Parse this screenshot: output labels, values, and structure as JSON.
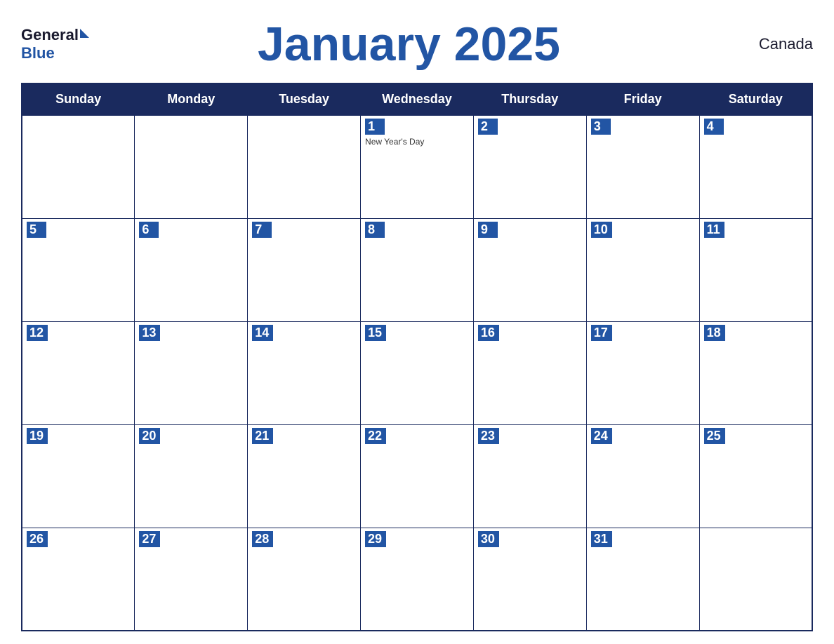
{
  "header": {
    "logo_general": "General",
    "logo_blue": "Blue",
    "title": "January 2025",
    "country": "Canada"
  },
  "days_of_week": [
    "Sunday",
    "Monday",
    "Tuesday",
    "Wednesday",
    "Thursday",
    "Friday",
    "Saturday"
  ],
  "weeks": [
    [
      {
        "day": "",
        "event": ""
      },
      {
        "day": "",
        "event": ""
      },
      {
        "day": "",
        "event": ""
      },
      {
        "day": "1",
        "event": "New Year's Day"
      },
      {
        "day": "2",
        "event": ""
      },
      {
        "day": "3",
        "event": ""
      },
      {
        "day": "4",
        "event": ""
      }
    ],
    [
      {
        "day": "5",
        "event": ""
      },
      {
        "day": "6",
        "event": ""
      },
      {
        "day": "7",
        "event": ""
      },
      {
        "day": "8",
        "event": ""
      },
      {
        "day": "9",
        "event": ""
      },
      {
        "day": "10",
        "event": ""
      },
      {
        "day": "11",
        "event": ""
      }
    ],
    [
      {
        "day": "12",
        "event": ""
      },
      {
        "day": "13",
        "event": ""
      },
      {
        "day": "14",
        "event": ""
      },
      {
        "day": "15",
        "event": ""
      },
      {
        "day": "16",
        "event": ""
      },
      {
        "day": "17",
        "event": ""
      },
      {
        "day": "18",
        "event": ""
      }
    ],
    [
      {
        "day": "19",
        "event": ""
      },
      {
        "day": "20",
        "event": ""
      },
      {
        "day": "21",
        "event": ""
      },
      {
        "day": "22",
        "event": ""
      },
      {
        "day": "23",
        "event": ""
      },
      {
        "day": "24",
        "event": ""
      },
      {
        "day": "25",
        "event": ""
      }
    ],
    [
      {
        "day": "26",
        "event": ""
      },
      {
        "day": "27",
        "event": ""
      },
      {
        "day": "28",
        "event": ""
      },
      {
        "day": "29",
        "event": ""
      },
      {
        "day": "30",
        "event": ""
      },
      {
        "day": "31",
        "event": ""
      },
      {
        "day": "",
        "event": ""
      }
    ]
  ]
}
